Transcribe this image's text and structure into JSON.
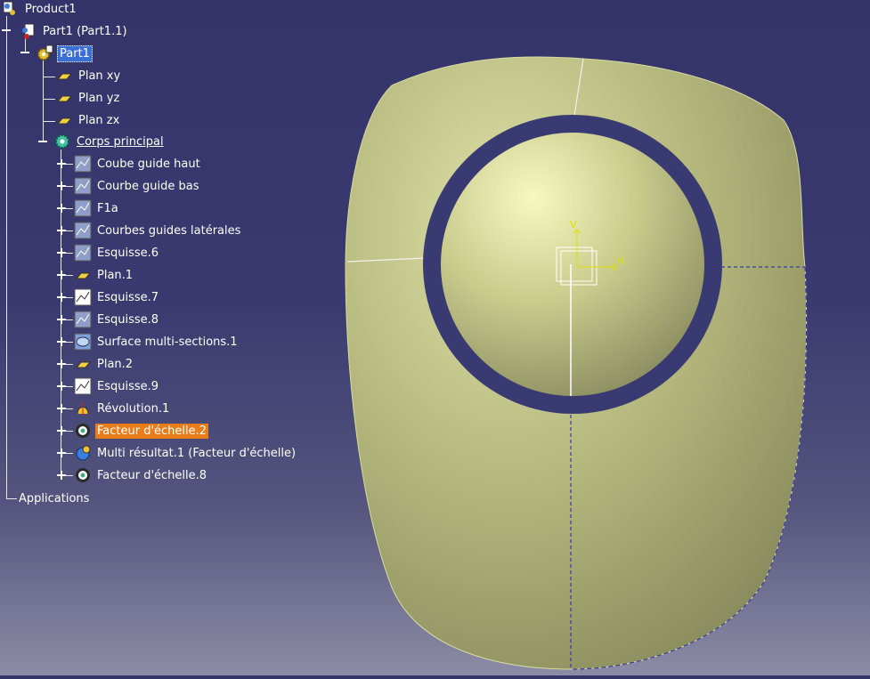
{
  "tree": {
    "root": {
      "label": "Product1",
      "icon": "product-icon"
    },
    "part_instance": {
      "label": "Part1 (Part1.1)",
      "icon": "part-instance-icon"
    },
    "part": {
      "label": "Part1",
      "icon": "part-gear-icon"
    },
    "planes": [
      {
        "label": "Plan xy",
        "icon": "plane-icon"
      },
      {
        "label": "Plan yz",
        "icon": "plane-icon"
      },
      {
        "label": "Plan zx",
        "icon": "plane-icon"
      }
    ],
    "body": {
      "label": "Corps principal",
      "icon": "body-gear-icon"
    },
    "features": [
      {
        "label": "Coube guide haut",
        "icon": "sketch-icon"
      },
      {
        "label": "Courbe guide bas",
        "icon": "sketch-icon"
      },
      {
        "label": "F1a",
        "icon": "sketch-icon"
      },
      {
        "label": "Courbes guides latérales",
        "icon": "sketch-icon"
      },
      {
        "label": "Esquisse.6",
        "icon": "sketch-icon"
      },
      {
        "label": "Plan.1",
        "icon": "plane-icon"
      },
      {
        "label": "Esquisse.7",
        "icon": "sketch-active-icon"
      },
      {
        "label": "Esquisse.8",
        "icon": "sketch-icon"
      },
      {
        "label": "Surface multi-sections.1",
        "icon": "multisection-surface-icon"
      },
      {
        "label": "Plan.2",
        "icon": "plane-icon"
      },
      {
        "label": "Esquisse.9",
        "icon": "sketch-active-icon"
      },
      {
        "label": "Révolution.1",
        "icon": "revolution-icon"
      },
      {
        "label": "Facteur d'échelle.2",
        "icon": "scaling-icon",
        "highlighted": true
      },
      {
        "label": "Multi résultat.1 (Facteur d'échelle)",
        "icon": "multi-result-icon"
      },
      {
        "label": "Facteur d'échelle.8",
        "icon": "scaling-icon"
      }
    ],
    "applications": {
      "label": "Applications"
    }
  },
  "viewport": {
    "axis_labels": {
      "v": "V",
      "h": "H"
    },
    "colors": {
      "surface": "#c9cc8e",
      "highlight": "#f2f4b8",
      "background": "#3a3a70",
      "selection": "#e87d1a"
    }
  }
}
